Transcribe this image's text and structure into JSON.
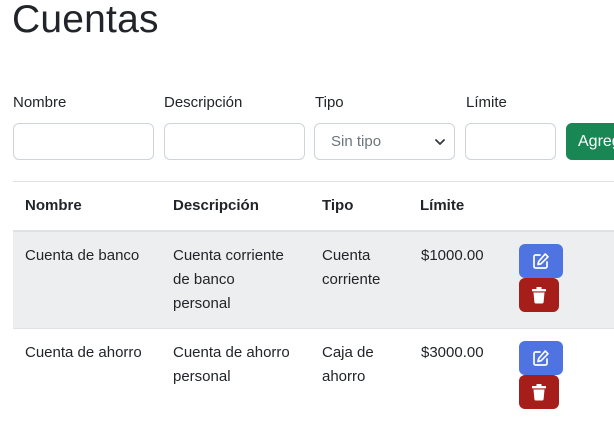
{
  "page": {
    "title": "Cuentas"
  },
  "form": {
    "nombre_label": "Nombre",
    "descripcion_label": "Descripción",
    "tipo_label": "Tipo",
    "limite_label": "Límite",
    "nombre_value": "",
    "descripcion_value": "",
    "limite_value": "",
    "tipo_selected": "Sin tipo",
    "add_label": "Agregar"
  },
  "table": {
    "headers": [
      "Nombre",
      "Descripción",
      "Tipo",
      "Límite"
    ],
    "rows": [
      {
        "nombre": "Cuenta de banco",
        "descripcion_lines": [
          "Cuenta corriente",
          "de banco",
          "personal"
        ],
        "tipo_lines": [
          "Cuenta",
          "corriente"
        ],
        "limite": "$1000.00"
      },
      {
        "nombre": "Cuenta de ahorro",
        "descripcion_lines": [
          "Cuenta de ahorro",
          "personal"
        ],
        "tipo_lines": [
          "Caja de",
          "ahorro"
        ],
        "limite": "$3000.00"
      }
    ]
  },
  "icons": {
    "edit": "edit-icon",
    "delete": "trash-icon",
    "select": "chevron-down-icon"
  },
  "colors": {
    "add": "#198754",
    "edit": "#4f73e0",
    "delete": "#a61e1a",
    "stripe": "#eceef0"
  }
}
